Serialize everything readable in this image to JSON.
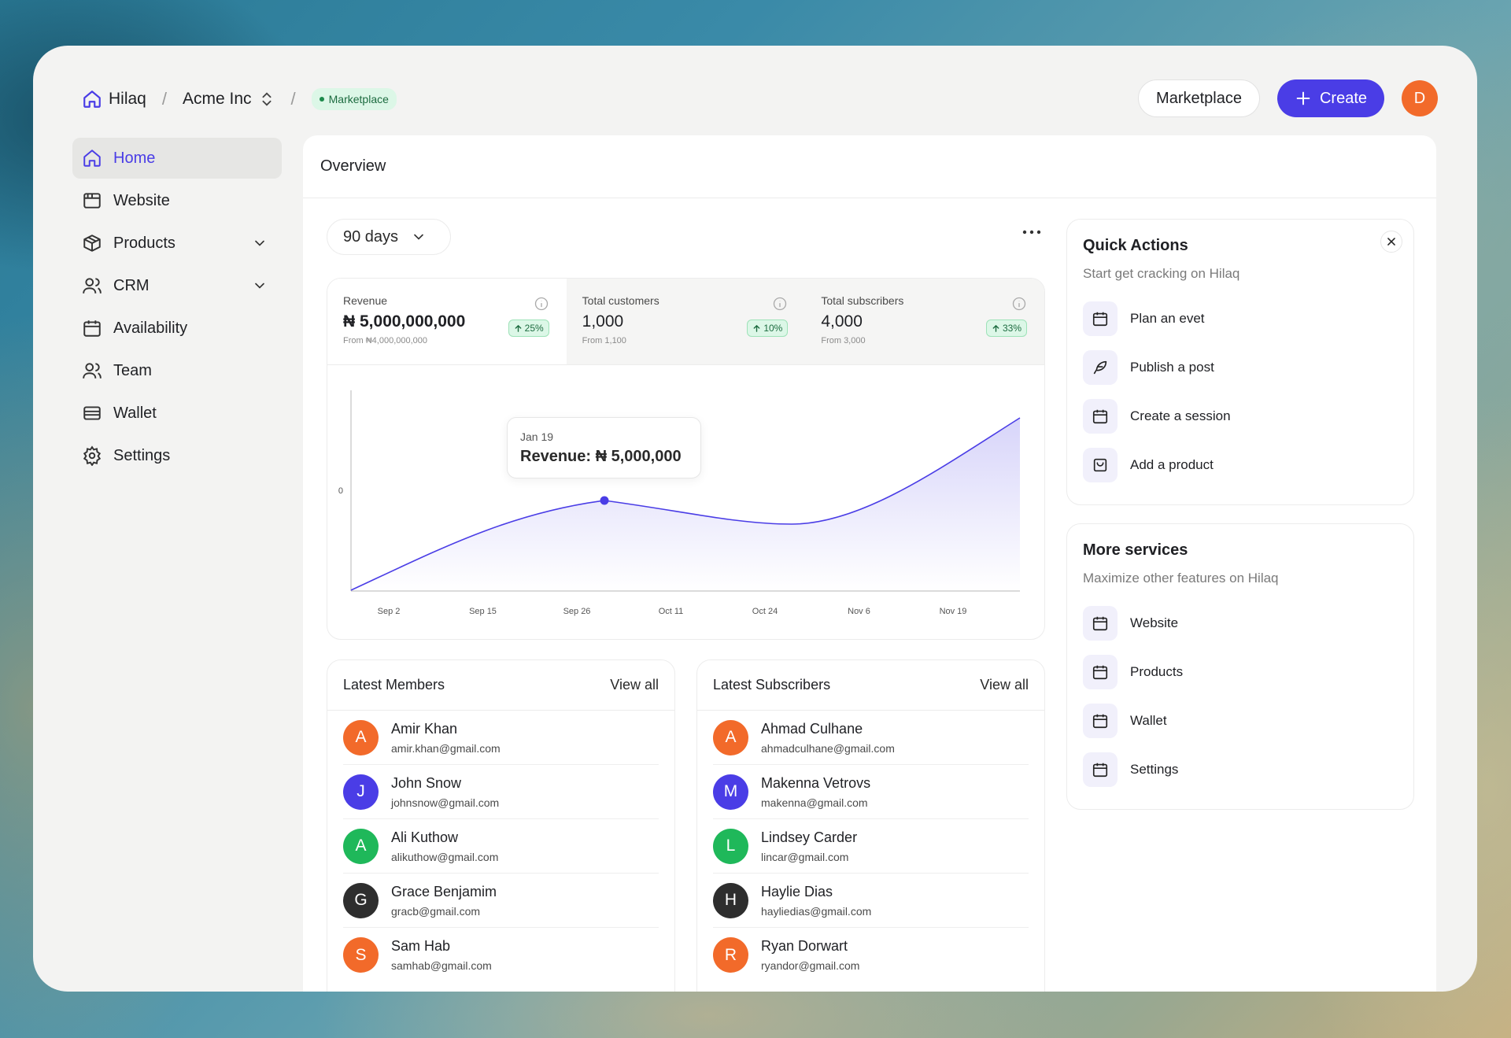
{
  "header": {
    "brand": "Hilaq",
    "org": "Acme Inc",
    "sep": "/",
    "pill": "Marketplace",
    "marketplace_button": "Marketplace",
    "create_button": "Create",
    "avatar_initial": "D"
  },
  "sidebar": {
    "items": [
      {
        "label": "Home"
      },
      {
        "label": "Website"
      },
      {
        "label": "Products"
      },
      {
        "label": "CRM"
      },
      {
        "label": "Availability"
      },
      {
        "label": "Team"
      },
      {
        "label": "Wallet"
      },
      {
        "label": "Settings"
      }
    ]
  },
  "main": {
    "title": "Overview",
    "range": "90 days"
  },
  "stats": [
    {
      "label": "Revenue",
      "value": "₦ 5,000,000,000",
      "from": "From ₦4,000,000,000",
      "change": "25%"
    },
    {
      "label": "Total customers",
      "value": "1,000",
      "from": "From 1,100",
      "change": "10%"
    },
    {
      "label": "Total subscribers",
      "value": "4,000",
      "from": "From 3,000",
      "change": "33%"
    }
  ],
  "chart_data": {
    "type": "area",
    "categories": [
      "Sep 2",
      "Sep 15",
      "Sep 26",
      "Oct 11",
      "Oct 24",
      "Nov 6",
      "Nov 19"
    ],
    "y_tick_labels": [
      "0"
    ],
    "tooltip": {
      "date": "Jan 19",
      "text": "Revenue: ₦ 5,000,000"
    },
    "color": "#4a3de6"
  },
  "members": {
    "title": "Latest Members",
    "view_all": "View all",
    "rows": [
      {
        "initial": "A",
        "name": "Amir Khan",
        "email": "amir.khan@gmail.com",
        "color": "#f26a2a"
      },
      {
        "initial": "J",
        "name": "John Snow",
        "email": "johnsnow@gmail.com",
        "color": "#4a3de6"
      },
      {
        "initial": "A",
        "name": "Ali Kuthow",
        "email": "alikuthow@gmail.com",
        "color": "#1fb85a"
      },
      {
        "initial": "G",
        "name": "Grace Benjamim",
        "email": "gracb@gmail.com",
        "color": "#2e2e2e"
      },
      {
        "initial": "S",
        "name": "Sam Hab",
        "email": "samhab@gmail.com",
        "color": "#f26a2a"
      }
    ]
  },
  "subscribers": {
    "title": "Latest Subscribers",
    "view_all": "View all",
    "rows": [
      {
        "initial": "A",
        "name": "Ahmad Culhane",
        "email": "ahmadculhane@gmail.com",
        "color": "#f26a2a"
      },
      {
        "initial": "M",
        "name": "Makenna Vetrovs",
        "email": "makenna@gmail.com",
        "color": "#4a3de6"
      },
      {
        "initial": "L",
        "name": "Lindsey Carder",
        "email": "lincar@gmail.com",
        "color": "#1fb85a"
      },
      {
        "initial": "H",
        "name": "Haylie Dias",
        "email": "hayliedias@gmail.com",
        "color": "#2e2e2e"
      },
      {
        "initial": "R",
        "name": "Ryan Dorwart",
        "email": "ryandor@gmail.com",
        "color": "#f26a2a"
      }
    ]
  },
  "quick_actions": {
    "title": "Quick Actions",
    "subtitle": "Start get cracking on Hilaq",
    "items": [
      "Plan an evet",
      "Publish a post",
      "Create a session",
      "Add a product"
    ]
  },
  "more_services": {
    "title": "More services",
    "subtitle": "Maximize other features on Hilaq",
    "items": [
      "Website",
      "Products",
      "Wallet",
      "Settings"
    ]
  },
  "colors": {
    "accent": "#4a3de6",
    "success": "#1c6b3f"
  }
}
